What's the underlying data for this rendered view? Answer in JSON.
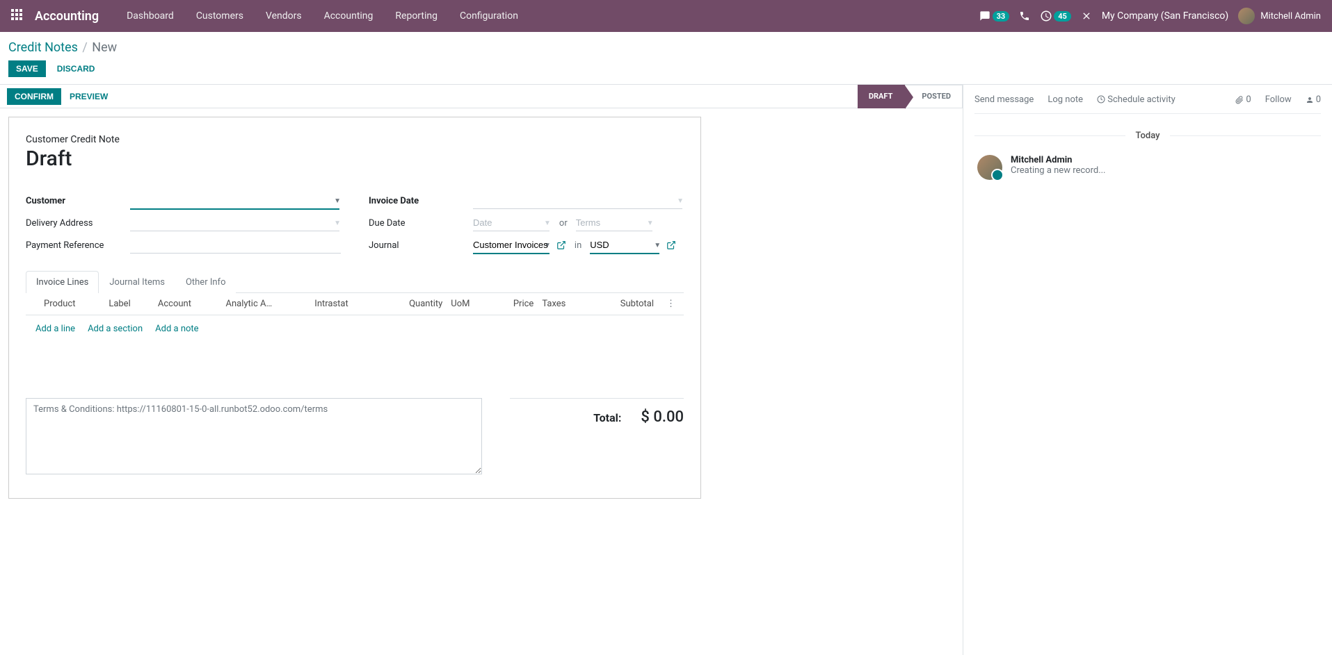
{
  "navbar": {
    "brand": "Accounting",
    "menu": [
      "Dashboard",
      "Customers",
      "Vendors",
      "Accounting",
      "Reporting",
      "Configuration"
    ],
    "messages_badge": "33",
    "activities_badge": "45",
    "company": "My Company (San Francisco)",
    "user": "Mitchell Admin"
  },
  "breadcrumb": {
    "parent": "Credit Notes",
    "current": "New"
  },
  "cp": {
    "save": "Save",
    "discard": "Discard"
  },
  "statusbar": {
    "confirm": "Confirm",
    "preview": "Preview",
    "steps": [
      "Draft",
      "Posted"
    ]
  },
  "sheet": {
    "subtitle": "Customer Credit Note",
    "title": "Draft",
    "labels": {
      "customer": "Customer",
      "delivery_address": "Delivery Address",
      "payment_reference": "Payment Reference",
      "invoice_date": "Invoice Date",
      "due_date": "Due Date",
      "journal": "Journal"
    },
    "due_date": {
      "date_ph": "Date",
      "or": "or",
      "terms_ph": "Terms"
    },
    "journal": {
      "value": "Customer Invoices",
      "in": "in",
      "currency": "USD"
    },
    "tabs": [
      "Invoice Lines",
      "Journal Items",
      "Other Info"
    ],
    "columns": [
      "Product",
      "Label",
      "Account",
      "Analytic A…",
      "Intrastat",
      "Quantity",
      "UoM",
      "Price",
      "Taxes",
      "Subtotal"
    ],
    "line_actions": {
      "add_line": "Add a line",
      "add_section": "Add a section",
      "add_note": "Add a note"
    },
    "terms": "Terms & Conditions: https://11160801-15-0-all.runbot52.odoo.com/terms",
    "totals": {
      "label": "Total:",
      "value": "$ 0.00"
    }
  },
  "chatter": {
    "send": "Send message",
    "log": "Log note",
    "schedule": "Schedule activity",
    "attach_count": "0",
    "follow": "Follow",
    "followers_count": "0",
    "today": "Today",
    "message": {
      "author": "Mitchell Admin",
      "text": "Creating a new record..."
    }
  }
}
